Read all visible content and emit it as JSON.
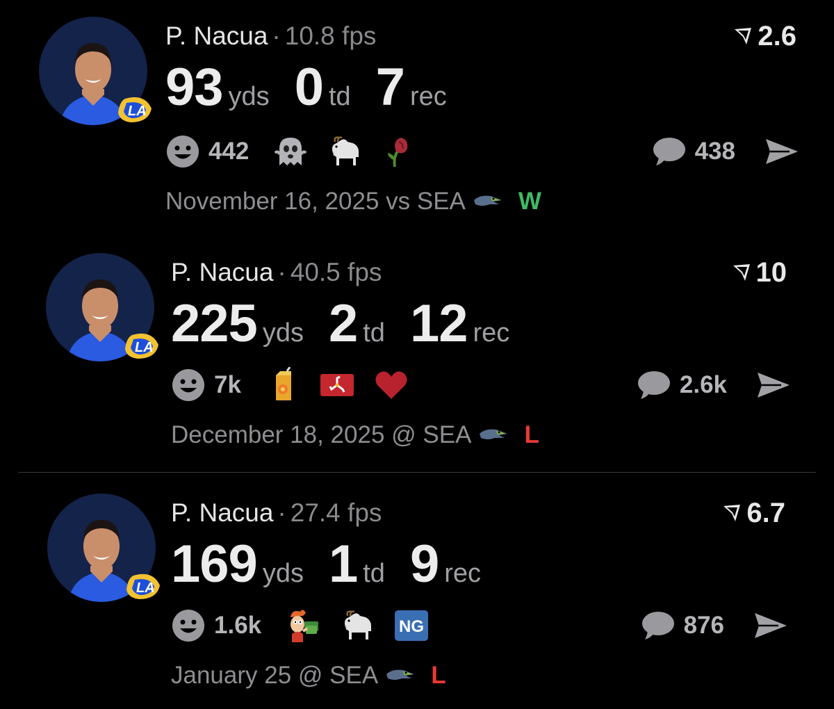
{
  "posts": [
    {
      "player_name": "P. Nacua",
      "separator": "·",
      "fps": "10.8 fps",
      "rating": "2.6",
      "yds_value": "93",
      "yds_unit": "yds",
      "td_value": "0",
      "td_unit": "td",
      "rec_value": "7",
      "rec_unit": "rec",
      "reaction_count": "442",
      "reaction_emojis": [
        "ghost-icon",
        "goat-icon",
        "wilted-rose-icon"
      ],
      "comment_count": "438",
      "date_text": "November 16, 2025 vs SEA",
      "opponent_logo": "seahawks-logo-icon",
      "result": "W",
      "result_color": "#3fb964"
    },
    {
      "player_name": "P. Nacua",
      "separator": "·",
      "fps": "40.5 fps",
      "rating": "10",
      "yds_value": "225",
      "yds_unit": "yds",
      "td_value": "2",
      "td_unit": "td",
      "rec_value": "12",
      "rec_unit": "rec",
      "reaction_count": "7k",
      "reaction_emojis": [
        "juice-box-icon",
        "isle-of-man-flag-icon",
        "red-heart-icon"
      ],
      "comment_count": "2.6k",
      "date_text": "December 18, 2025 @ SEA",
      "opponent_logo": "seahawks-logo-icon",
      "result": "L",
      "result_color": "#e63b33"
    },
    {
      "player_name": "P. Nacua",
      "separator": "·",
      "fps": "27.4 fps",
      "rating": "6.7",
      "yds_value": "169",
      "yds_unit": "yds",
      "td_value": "1",
      "td_unit": "td",
      "rec_value": "9",
      "rec_unit": "rec",
      "reaction_count": "1.6k",
      "reaction_emojis": [
        "fry-money-icon",
        "goat-icon",
        "ng-badge-icon"
      ],
      "comment_count": "876",
      "date_text": "January 25 @ SEA",
      "opponent_logo": "seahawks-logo-icon",
      "result": "L",
      "result_color": "#e63b33"
    }
  ],
  "ng_badge_text": "NG",
  "colors": {
    "background": "#000000",
    "win": "#3fb964",
    "loss": "#e63b33",
    "muted_text": "#8e8e92",
    "avatar_bg": "#14234a",
    "rams_blue": "#1e4fd8",
    "rams_gold": "#f2c230"
  }
}
